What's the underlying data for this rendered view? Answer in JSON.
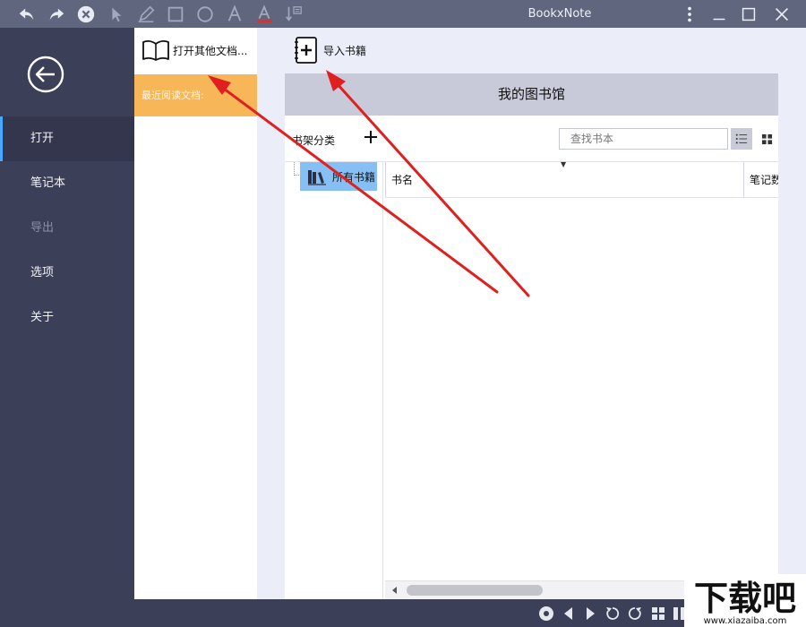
{
  "window": {
    "title": "BookxNote",
    "toolbar_icons": [
      "undo-icon",
      "redo-icon",
      "clear-icon",
      "pointer-icon",
      "pen-icon",
      "rectangle-icon",
      "circle-icon",
      "text-icon",
      "text-color-icon",
      "insert-icon"
    ],
    "controls": [
      "more-icon",
      "minimize-icon",
      "maximize-icon",
      "close-icon"
    ]
  },
  "nav": {
    "items": [
      {
        "label": "打开",
        "state": "active"
      },
      {
        "label": "笔记本",
        "state": "normal"
      },
      {
        "label": "导出",
        "state": "disabled"
      },
      {
        "label": "选项",
        "state": "normal"
      },
      {
        "label": "关于",
        "state": "normal"
      }
    ]
  },
  "middle": {
    "open_other_label": "打开其他文档...",
    "recent_label": "最近阅读文档:"
  },
  "library": {
    "import_label": "导入书籍",
    "header_title": "我的图书馆",
    "shelf_label": "书架分类",
    "search_placeholder": "查找书本",
    "all_books_label": "所有书籍",
    "columns": [
      "书名",
      "笔记数"
    ]
  },
  "colors": {
    "titlebar": "#61667f",
    "sidebar": "#3c3f58",
    "accent_orange": "#f7b758",
    "selected_blue": "#86bff3",
    "arrow_red": "#e02020"
  },
  "watermark": {
    "logo_text": "下载吧",
    "url_text": "www.xiazaiba.com"
  }
}
